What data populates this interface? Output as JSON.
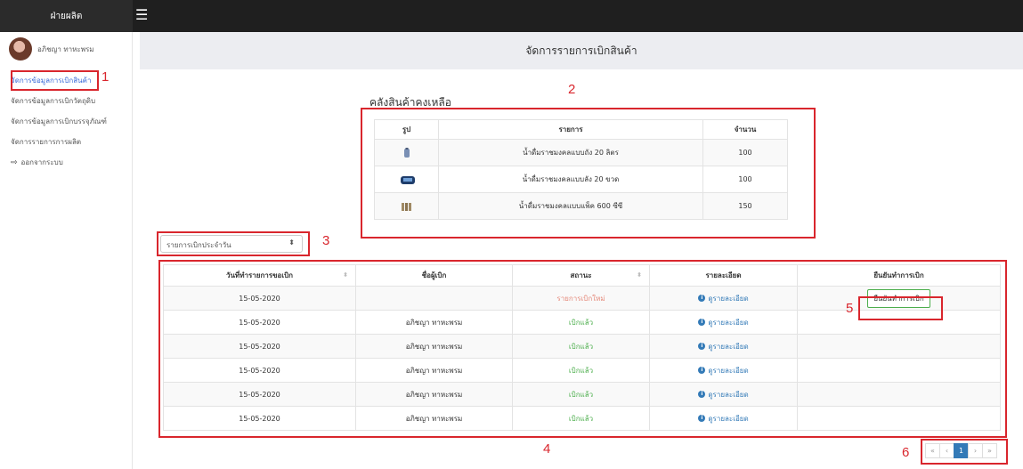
{
  "app": {
    "brand": "ฝ่ายผลิต"
  },
  "user": {
    "name": "อภิชญา ทาหะพรม"
  },
  "sidebar": {
    "items": [
      {
        "label": "จัดการข้อมูลการเบิกสินค้า"
      },
      {
        "label": "จัดการข้อมูลการเบิกวัตถุดิบ"
      },
      {
        "label": "จัดการข้อมูลการเบิกบรรจุภัณฑ์"
      },
      {
        "label": "จัดการรายการการผลิต"
      },
      {
        "label": "ออกจากระบบ"
      }
    ]
  },
  "page": {
    "title": "จัดการรายการเบิกสินค้า"
  },
  "stock": {
    "title": "คลังสินค้าคงเหลือ",
    "headers": [
      "รูป",
      "รายการ",
      "จำนวน"
    ],
    "rows": [
      {
        "name": "น้ำดื่มราชมงคลแบบถัง 20 ลิตร",
        "qty": "100",
        "icon": "water-tank-icon"
      },
      {
        "name": "น้ำดื่มราชมงคลแบบลัง 20 ขวด",
        "qty": "100",
        "icon": "water-crate-icon"
      },
      {
        "name": "น้ำดื่มราชมงคลแบบแพ็ค 600 ซีซี",
        "qty": "150",
        "icon": "water-pack-icon"
      }
    ]
  },
  "filter": {
    "selected": "รายการเบิกประจำวัน"
  },
  "orders": {
    "headers": [
      "วันที่ทำรายการขอเบิก",
      "ชื่อผู้เบิก",
      "สถานะ",
      "รายละเอียด",
      "ยืนยันทำการเบิก"
    ],
    "rows": [
      {
        "date": "15-05-2020",
        "requester": "",
        "status": "รายการเบิกใหม่",
        "detail": "ดูรายละเอียด",
        "action": "ยืนยันทำการเบิก"
      },
      {
        "date": "15-05-2020",
        "requester": "อภิชญา ทาหะพรม",
        "status": "เบิกแล้ว",
        "detail": "ดูรายละเอียด",
        "action": ""
      },
      {
        "date": "15-05-2020",
        "requester": "อภิชญา ทาหะพรม",
        "status": "เบิกแล้ว",
        "detail": "ดูรายละเอียด",
        "action": ""
      },
      {
        "date": "15-05-2020",
        "requester": "อภิชญา ทาหะพรม",
        "status": "เบิกแล้ว",
        "detail": "ดูรายละเอียด",
        "action": ""
      },
      {
        "date": "15-05-2020",
        "requester": "อภิชญา ทาหะพรม",
        "status": "เบิกแล้ว",
        "detail": "ดูรายละเอียด",
        "action": ""
      },
      {
        "date": "15-05-2020",
        "requester": "อภิชญา ทาหะพรม",
        "status": "เบิกแล้ว",
        "detail": "ดูรายละเอียด",
        "action": ""
      }
    ]
  },
  "pagination": {
    "first": "«",
    "prev": "‹",
    "current": "1",
    "next": "›",
    "last": "»"
  },
  "annotations": [
    "1",
    "2",
    "3",
    "4",
    "5",
    "6"
  ],
  "colors": {
    "annotation": "#d9262d",
    "accent": "#337ab7",
    "success": "#4cae4c"
  }
}
